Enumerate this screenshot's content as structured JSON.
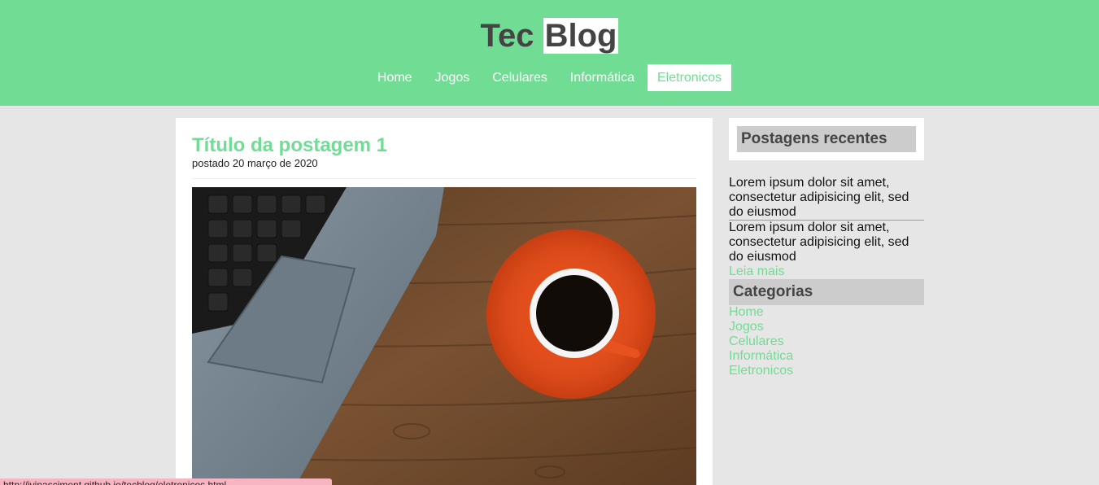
{
  "header": {
    "logo_part1": "Tec",
    "logo_part2": "Blog",
    "nav": [
      "Home",
      "Jogos",
      "Celulares",
      "Informática",
      "Eletronicos"
    ],
    "active_nav": "Eletronicos"
  },
  "post": {
    "title": "Título da postagem 1",
    "date": "postado 20 março de 2020",
    "image": "laptop-and-coffee-cup-photo"
  },
  "sidebar": {
    "recent_title": "Postagens recentes",
    "recent_items": [
      "Lorem ipsum dolor sit amet, consectetur adipisicing elit, sed do eiusmod",
      "Lorem ipsum dolor sit amet, consectetur adipisicing elit, sed do eiusmod"
    ],
    "read_more": "Leia mais",
    "categories_title": "Categorias",
    "categories": [
      "Home",
      "Jogos",
      "Celulares",
      "Informática",
      "Eletronicos"
    ]
  },
  "status_bar": {
    "url": "http://ivinasciment.github.io/tecblog/eletronicos.html"
  },
  "colors": {
    "accent": "#71dc93",
    "header_bg": "#71dc93",
    "page_bg": "#e6e6e6",
    "status_bg": "#f7b5c1"
  }
}
